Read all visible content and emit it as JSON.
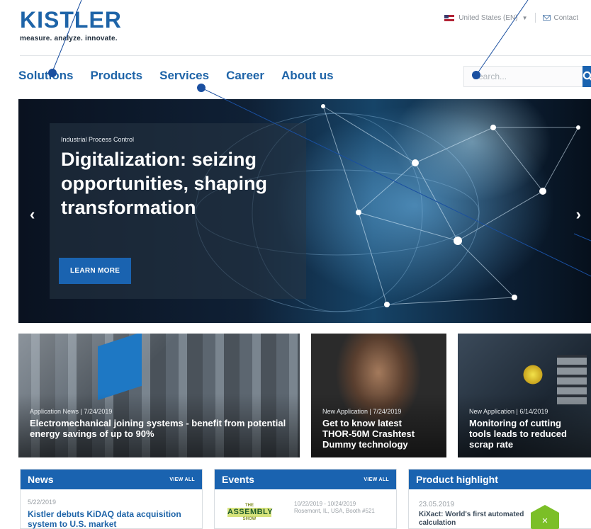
{
  "header": {
    "logo_text": "KISTLER",
    "tagline": "measure. analyze. innovate.",
    "country": "United States (EN)",
    "contact": "Contact"
  },
  "nav": {
    "items": [
      "Solutions",
      "Products",
      "Services",
      "Career",
      "About us"
    ]
  },
  "search": {
    "placeholder": "Search..."
  },
  "hero": {
    "kicker": "Industrial Process Control",
    "title": "Digitalization: seizing opportunities, shaping transformation",
    "cta": "LEARN MORE"
  },
  "tiles": [
    {
      "meta": "Application News  |  7/24/2019",
      "headline": "Electromechanical joining systems - benefit from potential energy savings of up to 90%"
    },
    {
      "meta": "New Application  |  7/24/2019",
      "headline": "Get to know latest THOR-50M Crashtest Dummy technology"
    },
    {
      "meta": "New Application  |  6/14/2019",
      "headline": "Monitoring of cutting tools leads to reduced scrap rate"
    }
  ],
  "news": {
    "title": "News",
    "view_all": "VIEW ALL",
    "date": "5/22/2019",
    "headline": "Kistler debuts KiDAQ data acquisition system to U.S. market"
  },
  "events": {
    "title": "Events",
    "view_all": "VIEW ALL",
    "logo_top": "THE",
    "logo_main": "ASSEMBLY",
    "logo_sub": "SHOW",
    "dates": "10/22/2019 - 10/24/2019",
    "location": "Rosemont, IL, USA, Booth #521"
  },
  "product_highlight": {
    "title": "Product highlight",
    "date": "23.05.2019",
    "headline": "KiXact: World's first automated calculation"
  },
  "colors": {
    "brand_blue": "#1a63b0",
    "logo_blue": "#1e64a8"
  }
}
